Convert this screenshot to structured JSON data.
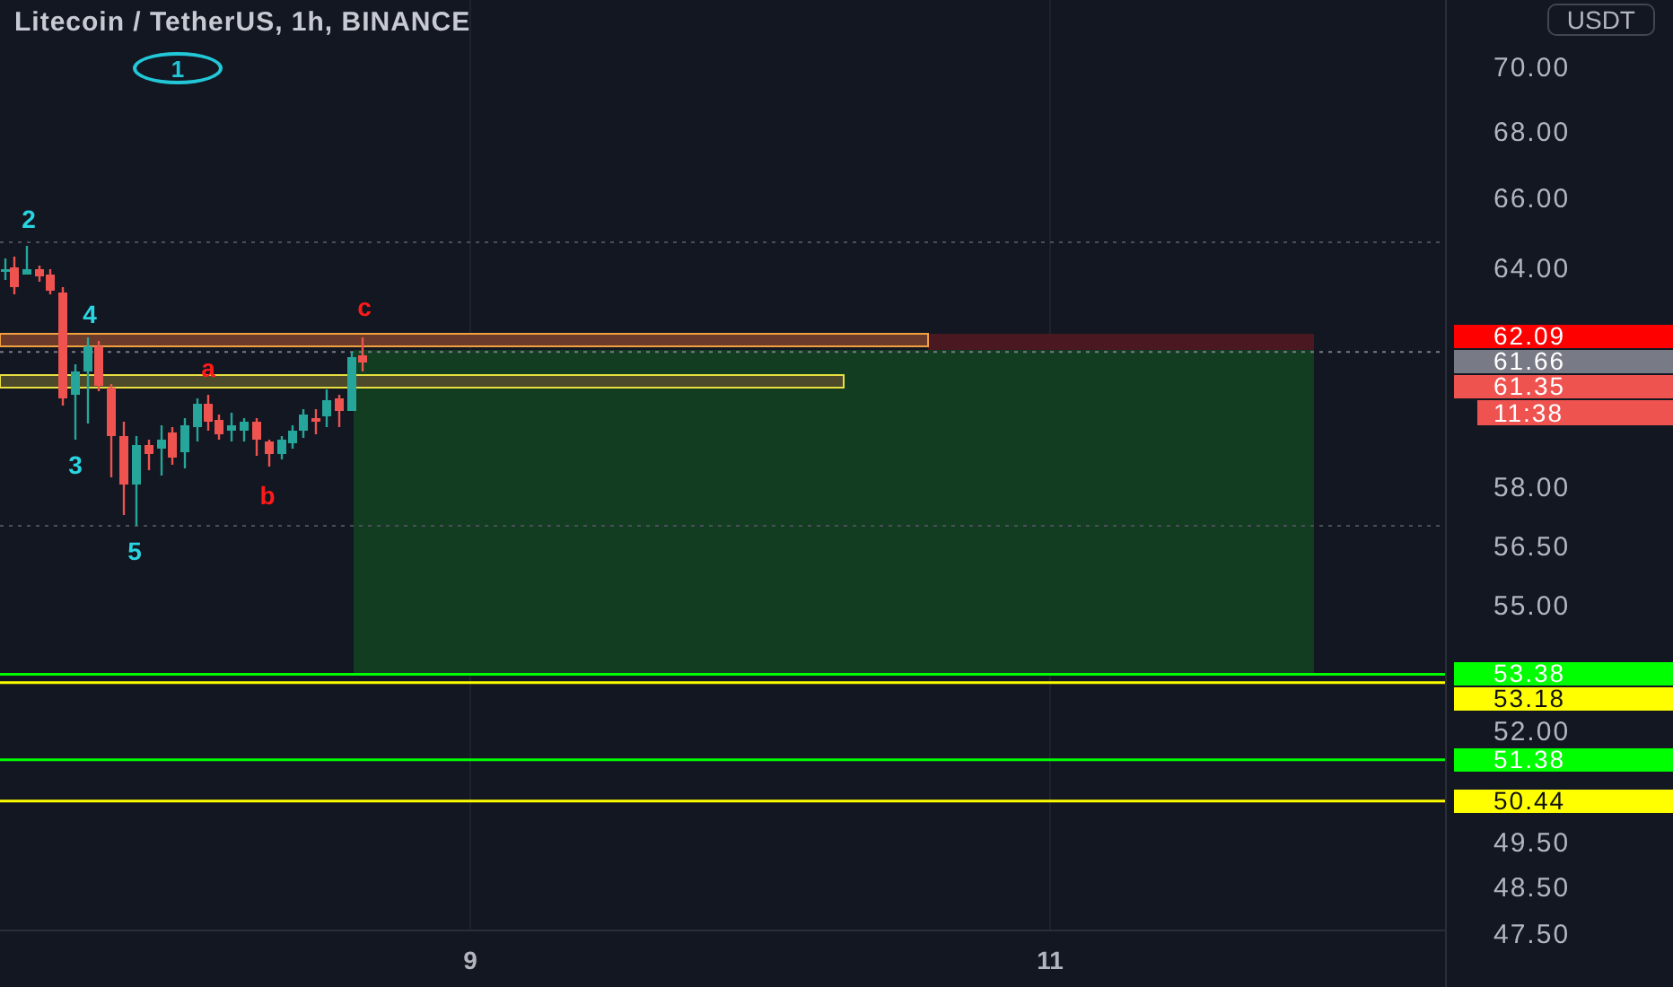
{
  "chart": {
    "title": "Litecoin / TetherUS, 1h, BINANCE",
    "badge": "1",
    "currency": "USDT",
    "price_ticks": [
      "70.00",
      "68.00",
      "66.00",
      "64.00",
      "58.00",
      "56.50",
      "55.00",
      "52.00",
      "49.50",
      "48.50",
      "47.50"
    ],
    "price_markers": [
      {
        "label": "62.09",
        "color": "#ff0000"
      },
      {
        "label": "61.66",
        "color": "#787b86"
      },
      {
        "label": "61.35",
        "color": "#ef5350"
      },
      {
        "label": "53.38",
        "color": "#00ff00"
      },
      {
        "label": "53.18",
        "color": "#ffff00"
      },
      {
        "label": "51.38",
        "color": "#00ff00"
      },
      {
        "label": "50.44",
        "color": "#ffff00"
      }
    ],
    "countdown": "11:38",
    "time_ticks": [
      "9",
      "11"
    ],
    "wave_labels": [
      {
        "text": "2",
        "color": "#2ad4e0"
      },
      {
        "text": "4",
        "color": "#2ad4e0"
      },
      {
        "text": "3",
        "color": "#2ad4e0"
      },
      {
        "text": "5",
        "color": "#2ad4e0"
      },
      {
        "text": "a",
        "color": "#ff1a1a"
      },
      {
        "text": "b",
        "color": "#ff1a1a"
      },
      {
        "text": "c",
        "color": "#ff1a1a"
      }
    ]
  }
}
